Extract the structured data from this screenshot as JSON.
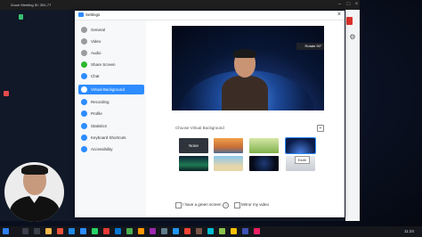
{
  "zoom_window": {
    "title": "Zoom Meeting ID: 351-77"
  },
  "settings": {
    "title": "Settings",
    "nav": [
      {
        "label": "General",
        "icon": "gear-icon",
        "color": "#8c8c8c"
      },
      {
        "label": "Video",
        "icon": "video-icon",
        "color": "#8c8c8c"
      },
      {
        "label": "Audio",
        "icon": "headphones-icon",
        "color": "#8c8c8c"
      },
      {
        "label": "Share Screen",
        "icon": "share-screen-icon",
        "color": "#2eb82e"
      },
      {
        "label": "Chat",
        "icon": "chat-icon",
        "color": "#2d8cff"
      },
      {
        "label": "Virtual Background",
        "icon": "person-icon",
        "color": "#ffffff"
      },
      {
        "label": "Recording",
        "icon": "record-icon",
        "color": "#2d8cff"
      },
      {
        "label": "Profile",
        "icon": "profile-icon",
        "color": "#2d8cff"
      },
      {
        "label": "Statistics",
        "icon": "statistics-icon",
        "color": "#2d8cff"
      },
      {
        "label": "Keyboard Shortcuts",
        "icon": "keyboard-icon",
        "color": "#2d8cff"
      },
      {
        "label": "Accessibility",
        "icon": "accessibility-icon",
        "color": "#2d8cff"
      }
    ],
    "active_index": 5,
    "rotate_label": "Rotate 90°",
    "choose_label": "Choose Virtual Background",
    "thumbnails": [
      {
        "label": "None"
      },
      {
        "label": ""
      },
      {
        "label": ""
      },
      {
        "label": ""
      },
      {
        "label": ""
      },
      {
        "label": ""
      },
      {
        "label": ""
      },
      {
        "label": ""
      }
    ],
    "tooltip": "Earth",
    "green_screen_label": "I have a green screen",
    "mirror_label": "Mirror my video"
  },
  "taskbar": {
    "time": "11:24"
  },
  "colors": {
    "accent": "#2d8cff",
    "taskbar": "#15171c"
  }
}
